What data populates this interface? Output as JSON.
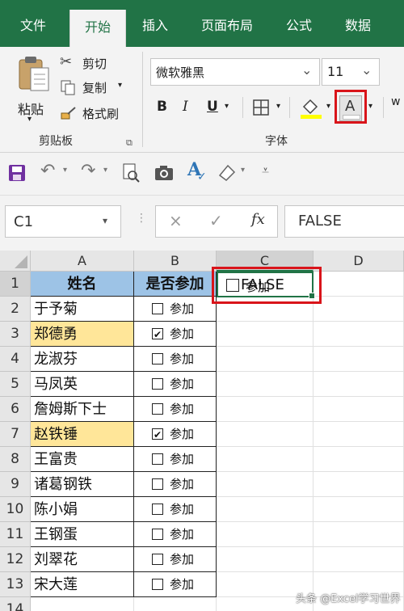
{
  "tabs": [
    "文件",
    "开始",
    "插入",
    "页面布局",
    "公式",
    "数据"
  ],
  "clipboard": {
    "paste": "粘贴",
    "cut": "剪切",
    "copy": "复制",
    "format_painter": "格式刷",
    "group_label": "剪贴板"
  },
  "font": {
    "name": "微软雅黑",
    "size": "11",
    "bold": "B",
    "italic": "I",
    "underline": "U",
    "font_color": "A",
    "group_label": "字体",
    "right_edge_char": "w"
  },
  "formula_bar": {
    "name_box": "C1",
    "cancel": "×",
    "enter": "✓",
    "fx": "fx",
    "value": "FALSE"
  },
  "columns": [
    "A",
    "B",
    "C",
    "D"
  ],
  "rows": [
    "1",
    "2",
    "3",
    "4",
    "5",
    "6",
    "7",
    "8",
    "9",
    "10",
    "11",
    "12",
    "13",
    "14"
  ],
  "table": {
    "header": [
      "姓名",
      "是否参加"
    ],
    "checkbox_label": "参加",
    "records": [
      {
        "name": "于予菊",
        "checked": false,
        "highlight": false
      },
      {
        "name": "郑德勇",
        "checked": true,
        "highlight": true
      },
      {
        "name": "龙淑芬",
        "checked": false,
        "highlight": false
      },
      {
        "name": "马凤英",
        "checked": false,
        "highlight": false
      },
      {
        "name": "詹姆斯下士",
        "checked": false,
        "highlight": false
      },
      {
        "name": "赵铁锤",
        "checked": true,
        "highlight": true
      },
      {
        "name": "王富贵",
        "checked": false,
        "highlight": false
      },
      {
        "name": "诸葛钢铁",
        "checked": false,
        "highlight": false
      },
      {
        "name": "陈小娟",
        "checked": false,
        "highlight": false
      },
      {
        "name": "王钢蛋",
        "checked": false,
        "highlight": false
      },
      {
        "name": "刘翠花",
        "checked": false,
        "highlight": false
      },
      {
        "name": "宋大莲",
        "checked": false,
        "highlight": false
      }
    ]
  },
  "c1": {
    "value": "FALSE",
    "checkbox_label": "参加"
  },
  "watermark": "头条 @Excel学习世界",
  "colors": {
    "excel_green": "#217346",
    "header_blue": "#9dc3e6",
    "highlight_yellow": "#ffe699",
    "callout_red": "#d9141a"
  }
}
